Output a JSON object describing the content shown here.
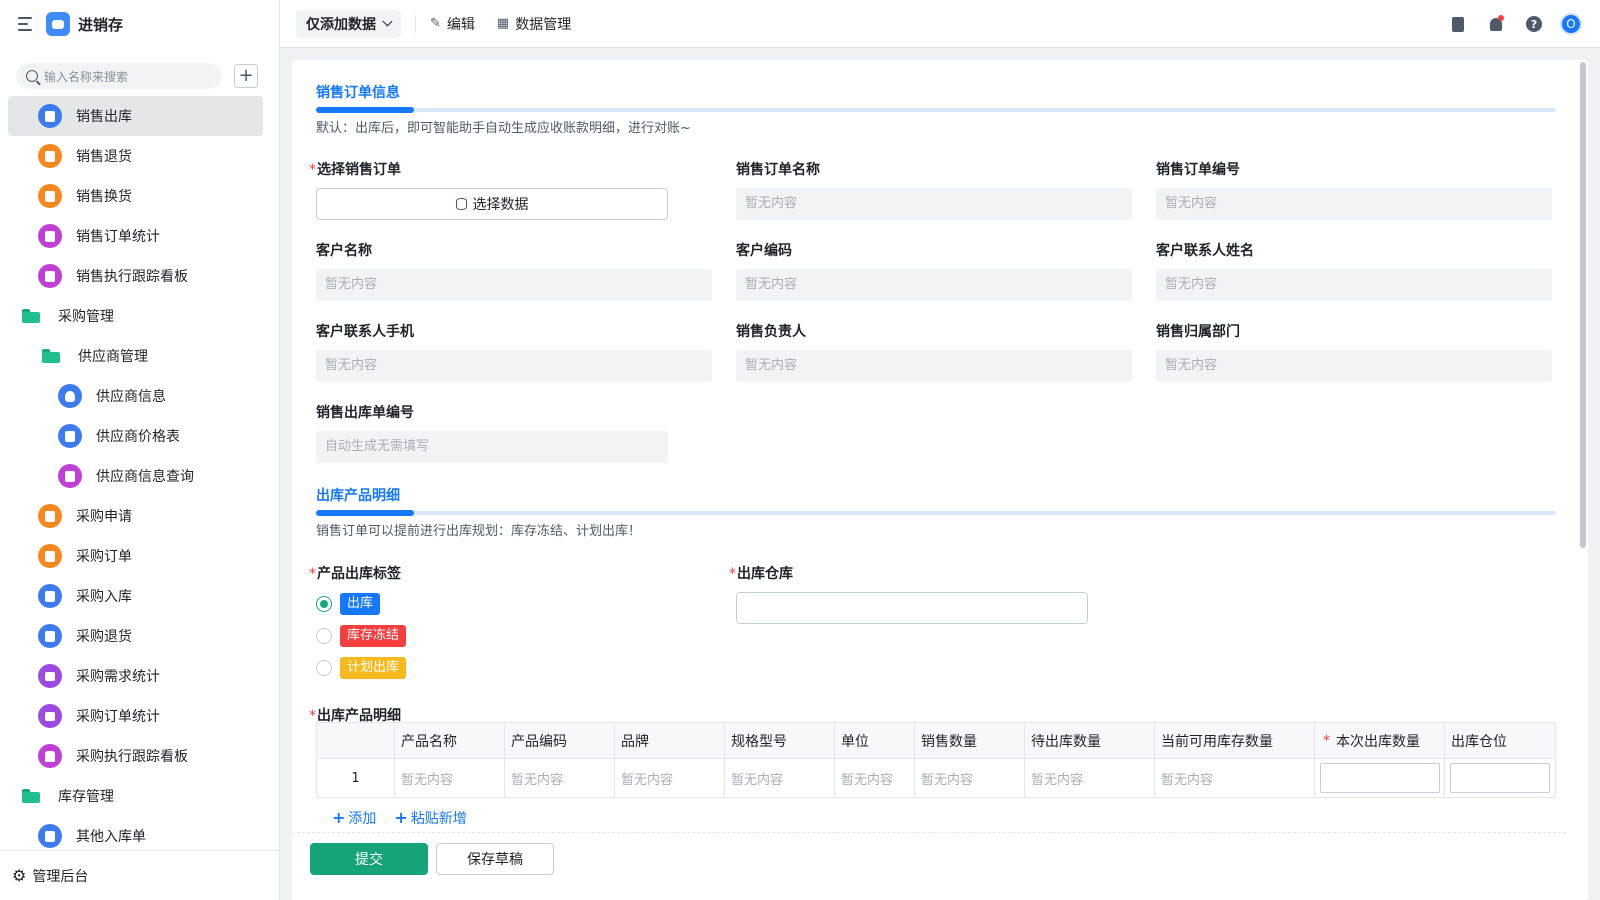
{
  "app": {
    "title": "进销存"
  },
  "sidebar": {
    "search_placeholder": "输入名称来搜索",
    "items": [
      {
        "label": "销售出库",
        "icon": "document-icon",
        "color": "#3d7cf0",
        "level": 1,
        "active": true
      },
      {
        "label": "销售退货",
        "icon": "box-icon",
        "color": "#f7871e",
        "level": 1
      },
      {
        "label": "销售换货",
        "icon": "box-icon",
        "color": "#f7871e",
        "level": 1
      },
      {
        "label": "销售订单统计",
        "icon": "chart-icon",
        "color": "#c040d6",
        "level": 1
      },
      {
        "label": "销售执行跟踪看板",
        "icon": "chart-icon",
        "color": "#c040d6",
        "level": 1
      },
      {
        "label": "采购管理",
        "icon": "folder-icon",
        "level": 0
      },
      {
        "label": "供应商管理",
        "icon": "folder-icon",
        "level": 2
      },
      {
        "label": "供应商信息",
        "icon": "user-icon",
        "color": "#3d7cf0",
        "level": 3
      },
      {
        "label": "供应商价格表",
        "icon": "document-icon",
        "color": "#3d7cf0",
        "level": 3
      },
      {
        "label": "供应商信息查询",
        "icon": "chart-icon",
        "color": "#c040d6",
        "level": 3
      },
      {
        "label": "采购申请",
        "icon": "box-icon",
        "color": "#f7871e",
        "level": 1
      },
      {
        "label": "采购订单",
        "icon": "box-icon",
        "color": "#f7871e",
        "level": 1
      },
      {
        "label": "采购入库",
        "icon": "document-icon",
        "color": "#3d7cf0",
        "level": 1
      },
      {
        "label": "采购退货",
        "icon": "document-icon",
        "color": "#3d7cf0",
        "level": 1
      },
      {
        "label": "采购需求统计",
        "icon": "bar-chart-icon",
        "color": "#9c4be0",
        "level": 1
      },
      {
        "label": "采购订单统计",
        "icon": "bar-chart-icon",
        "color": "#9c4be0",
        "level": 1
      },
      {
        "label": "采购执行跟踪看板",
        "icon": "home-icon",
        "color": "#c040d6",
        "level": 1
      },
      {
        "label": "库存管理",
        "icon": "folder-icon",
        "level": 0
      },
      {
        "label": "其他入库单",
        "icon": "document-icon",
        "color": "#3d7cf0",
        "level": 1
      }
    ],
    "footer_label": "管理后台"
  },
  "topbar": {
    "mode": "仅添加数据",
    "edit": "编辑",
    "data_manage": "数据管理",
    "avatar_letter": "O"
  },
  "form": {
    "section1": {
      "title": "销售订单信息",
      "desc": "默认：出库后，即可智能助手自动生成应收账款明细，进行对账~",
      "select_order_label": "选择销售订单",
      "select_btn": "选择数据",
      "fields": [
        {
          "label": "销售订单名称",
          "value": "暂无内容"
        },
        {
          "label": "销售订单编号",
          "value": "暂无内容"
        },
        {
          "label": "客户名称",
          "value": "暂无内容"
        },
        {
          "label": "客户编码",
          "value": "暂无内容"
        },
        {
          "label": "客户联系人姓名",
          "value": "暂无内容"
        },
        {
          "label": "客户联系人手机",
          "value": "暂无内容"
        },
        {
          "label": "销售负责人",
          "value": "暂无内容"
        },
        {
          "label": "销售归属部门",
          "value": "暂无内容"
        },
        {
          "label": "销售出库单编号",
          "value": "自动生成无需填写"
        }
      ]
    },
    "section2": {
      "title": "出库产品明细",
      "desc": "销售订单可以提前进行出库规划：库存冻结、计划出库！",
      "tag_label": "产品出库标签",
      "tags": [
        {
          "label": "出库",
          "color": "#1677ff",
          "checked": true
        },
        {
          "label": "库存冻结",
          "color": "#f53f3f",
          "checked": false
        },
        {
          "label": "计划出库",
          "color": "#f7ba1e",
          "checked": false
        }
      ],
      "warehouse_label": "出库仓库",
      "detail_label": "出库产品明细",
      "table": {
        "headers": [
          "",
          "产品名称",
          "产品编码",
          "品牌",
          "规格型号",
          "单位",
          "销售数量",
          "待出库数量",
          "当前可用库存数量",
          "本次出库数量",
          "出库仓位"
        ],
        "rows": [
          [
            "1",
            "暂无内容",
            "暂无内容",
            "暂无内容",
            "暂无内容",
            "暂无内容",
            "暂无内容",
            "暂无内容",
            "暂无内容",
            "",
            ""
          ]
        ]
      },
      "add": "添加",
      "paste_add": "粘贴新增"
    },
    "submit": "提交",
    "save_draft": "保存草稿"
  }
}
